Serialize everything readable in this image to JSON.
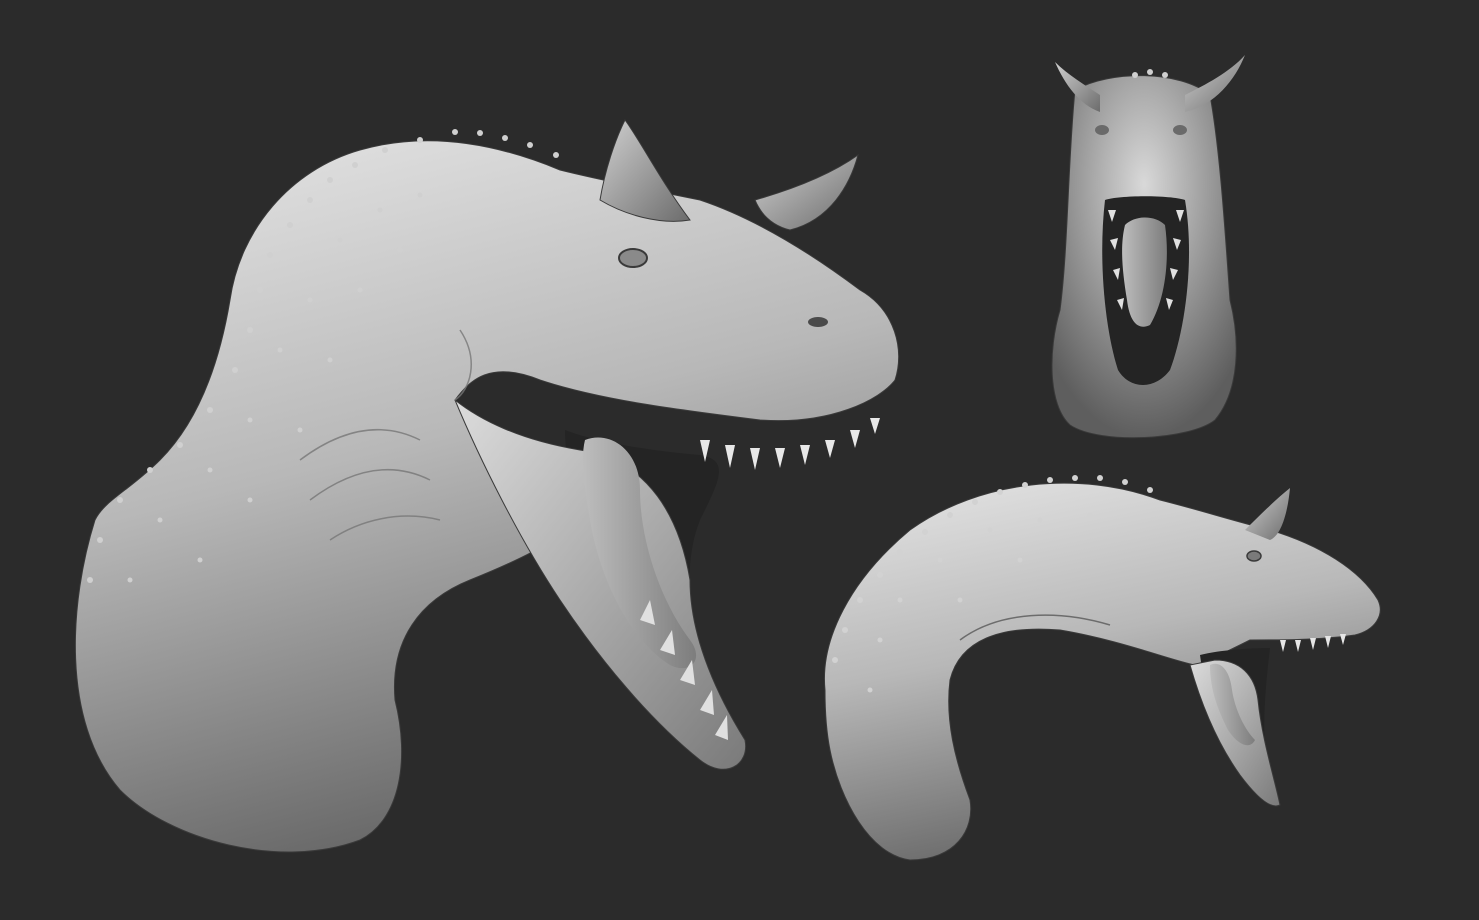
{
  "scene": {
    "background_color": "#2b2b2b",
    "clay_light": "#e2e2e2",
    "clay_mid": "#a9a9a9",
    "clay_dark": "#4a4a4a",
    "mouth_dark": "#1f1f1f",
    "views": [
      {
        "name": "side-view"
      },
      {
        "name": "front-view"
      },
      {
        "name": "three-quarter-view"
      }
    ]
  }
}
